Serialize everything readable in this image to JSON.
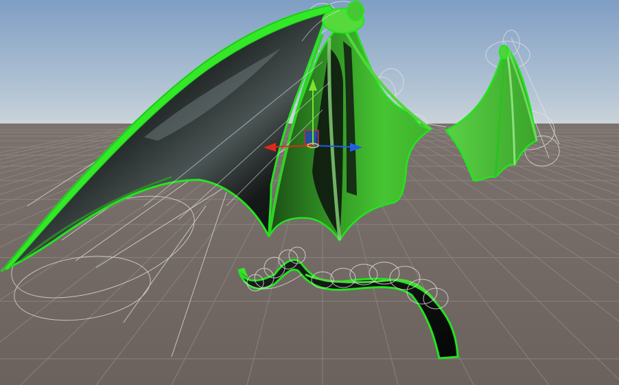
{
  "scene_view": {
    "sky_top_color": "#7f9ec4",
    "sky_horizon_color": "#c9d3dc",
    "ground_color": "#6f6661",
    "grid_color": "#8f8782",
    "selection_outline_color": "#22e51e",
    "wing_membrane_dark": "#0f1210",
    "wing_membrane_green": "#3fc52b"
  },
  "transform_gizmo": {
    "x_axis_color": "#e0281b",
    "y_axis_color": "#7be232",
    "z_axis_color": "#2060e8",
    "plane_handle_color": "#1f3fd0",
    "plane_handle_edge_color": "#c4302a"
  },
  "objects": [
    {
      "name": "left-wing",
      "icon": "bat-wing-mesh"
    },
    {
      "name": "right-wing",
      "icon": "bat-wing-mesh"
    },
    {
      "name": "tail",
      "icon": "tail-mesh"
    }
  ],
  "physics_colliders": {
    "color": "#e6e6e6",
    "shape": "capsule-wireframe"
  }
}
